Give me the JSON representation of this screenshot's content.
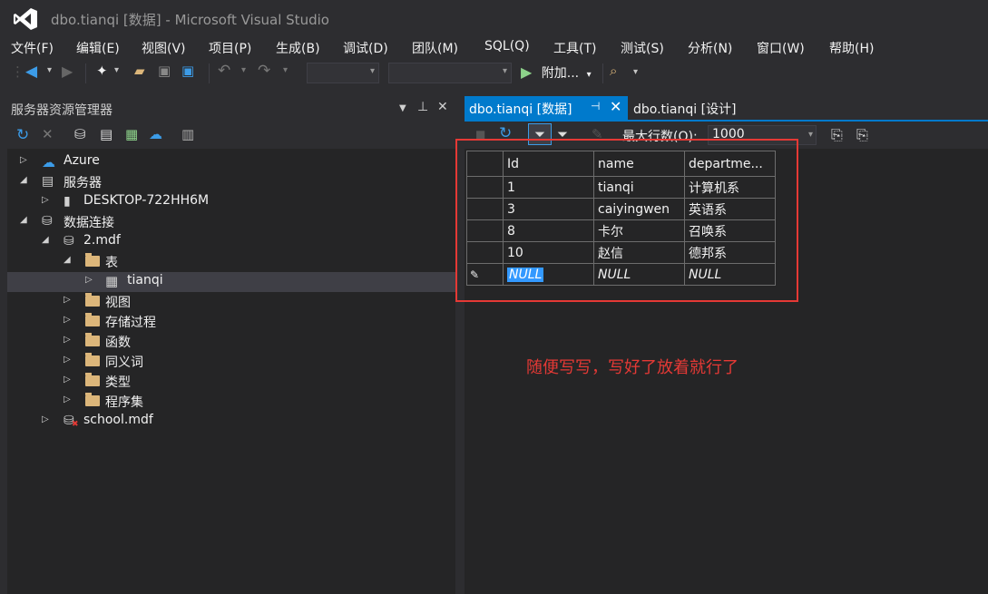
{
  "window": {
    "title": "dbo.tianqi [数据] - Microsoft Visual Studio"
  },
  "menu": [
    "文件(F)",
    "编辑(E)",
    "视图(V)",
    "项目(P)",
    "生成(B)",
    "调试(D)",
    "团队(M)",
    "SQL(Q)",
    "工具(T)",
    "测试(S)",
    "分析(N)",
    "窗口(W)",
    "帮助(H)"
  ],
  "toolbar": {
    "attach_label": "附加..."
  },
  "server_explorer": {
    "title": "服务器资源管理器",
    "tree": [
      {
        "label": "Azure",
        "level": 0,
        "arrow": "▷",
        "icon": "azure-cloud-icon"
      },
      {
        "label": "服务器",
        "level": 0,
        "arrow": "◢",
        "icon": "server-icon"
      },
      {
        "label": "DESKTOP-722HH6M",
        "level": 1,
        "arrow": "▷",
        "icon": "computer-icon"
      },
      {
        "label": "数据连接",
        "level": 0,
        "arrow": "◢",
        "icon": "data-connection-icon"
      },
      {
        "label": "2.mdf",
        "level": 1,
        "arrow": "◢",
        "icon": "database-icon"
      },
      {
        "label": "表",
        "level": 2,
        "arrow": "◢",
        "icon": "folder-icon"
      },
      {
        "label": "tianqi",
        "level": 3,
        "arrow": "▷",
        "icon": "table-icon",
        "selected": true
      },
      {
        "label": "视图",
        "level": 2,
        "arrow": "▷",
        "icon": "folder-icon"
      },
      {
        "label": "存储过程",
        "level": 2,
        "arrow": "▷",
        "icon": "folder-icon"
      },
      {
        "label": "函数",
        "level": 2,
        "arrow": "▷",
        "icon": "folder-icon"
      },
      {
        "label": "同义词",
        "level": 2,
        "arrow": "▷",
        "icon": "folder-icon"
      },
      {
        "label": "类型",
        "level": 2,
        "arrow": "▷",
        "icon": "folder-icon"
      },
      {
        "label": "程序集",
        "level": 2,
        "arrow": "▷",
        "icon": "folder-icon"
      },
      {
        "label": "school.mdf",
        "level": 1,
        "arrow": "▷",
        "icon": "database-error-icon"
      }
    ]
  },
  "tabs": {
    "active": "dbo.tianqi [数据]",
    "inactive": "dbo.tianqi [设计]"
  },
  "data_toolbar": {
    "max_rows_label": "最大行数(O):",
    "max_rows_value": "1000"
  },
  "grid": {
    "columns": [
      "Id",
      "name",
      "departme..."
    ],
    "rows": [
      [
        "1",
        "tianqi",
        "计算机系"
      ],
      [
        "3",
        "caiyingwen",
        "英语系"
      ],
      [
        "8",
        "卡尔",
        "召唤系"
      ],
      [
        "10",
        "赵信",
        "德邦系"
      ]
    ],
    "new_row": [
      "NULL",
      "NULL",
      "NULL"
    ]
  },
  "annotation": "随便写写，写好了放着就行了",
  "colors": {
    "accent": "#007acc",
    "annotation_red": "#e53935",
    "background": "#2d2d30"
  }
}
